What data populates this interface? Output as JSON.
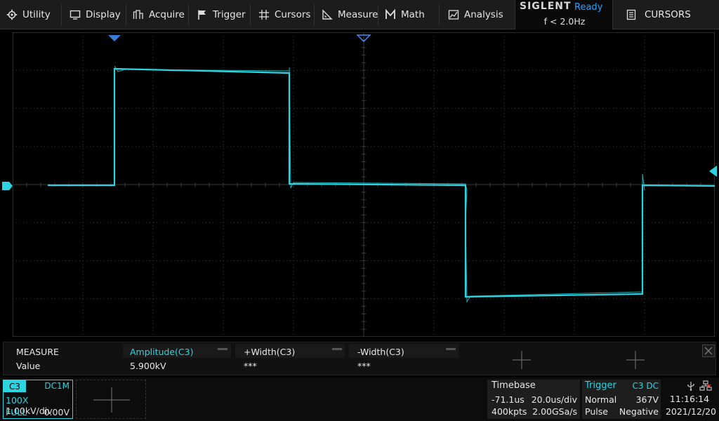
{
  "menu": {
    "utility": "Utility",
    "display": "Display",
    "acquire": "Acquire",
    "trigger": "Trigger",
    "cursors": "Cursors",
    "measure": "Measure",
    "math": "Math",
    "analysis": "Analysis"
  },
  "brand": {
    "name": "SIGLENT",
    "status": "Ready",
    "freq": "f < 2.0Hz"
  },
  "active_menu": "CURSORS",
  "measure": {
    "header": "MEASURE",
    "row_label": "Value",
    "items": [
      {
        "name": "Amplitude(C3)",
        "value": "5.900kV"
      },
      {
        "name": "+Width(C3)",
        "value": "***"
      },
      {
        "name": "-Width(C3)",
        "value": "***"
      }
    ]
  },
  "channel": {
    "tag": "C3",
    "coupling": "DC1M",
    "probe": "100X",
    "scale": "1.00kV/div",
    "bandwidth": "FULL",
    "offset": "0.00V"
  },
  "timebase": {
    "title": "Timebase",
    "delay": "-71.1us",
    "scale": "20.0us/div",
    "memory": "400kpts",
    "sample_rate": "2.00GSa/s"
  },
  "trigger": {
    "title": "Trigger",
    "source": "C3 DC",
    "mode": "Normal",
    "level": "367V",
    "type": "Pulse",
    "polarity": "Negative"
  },
  "clock": {
    "time": "11:16:14",
    "date": "2021/12/20"
  },
  "colors": {
    "channel": "#2bd4e0",
    "status": "#2aa0ff",
    "grid": "#3a3a3a"
  }
}
